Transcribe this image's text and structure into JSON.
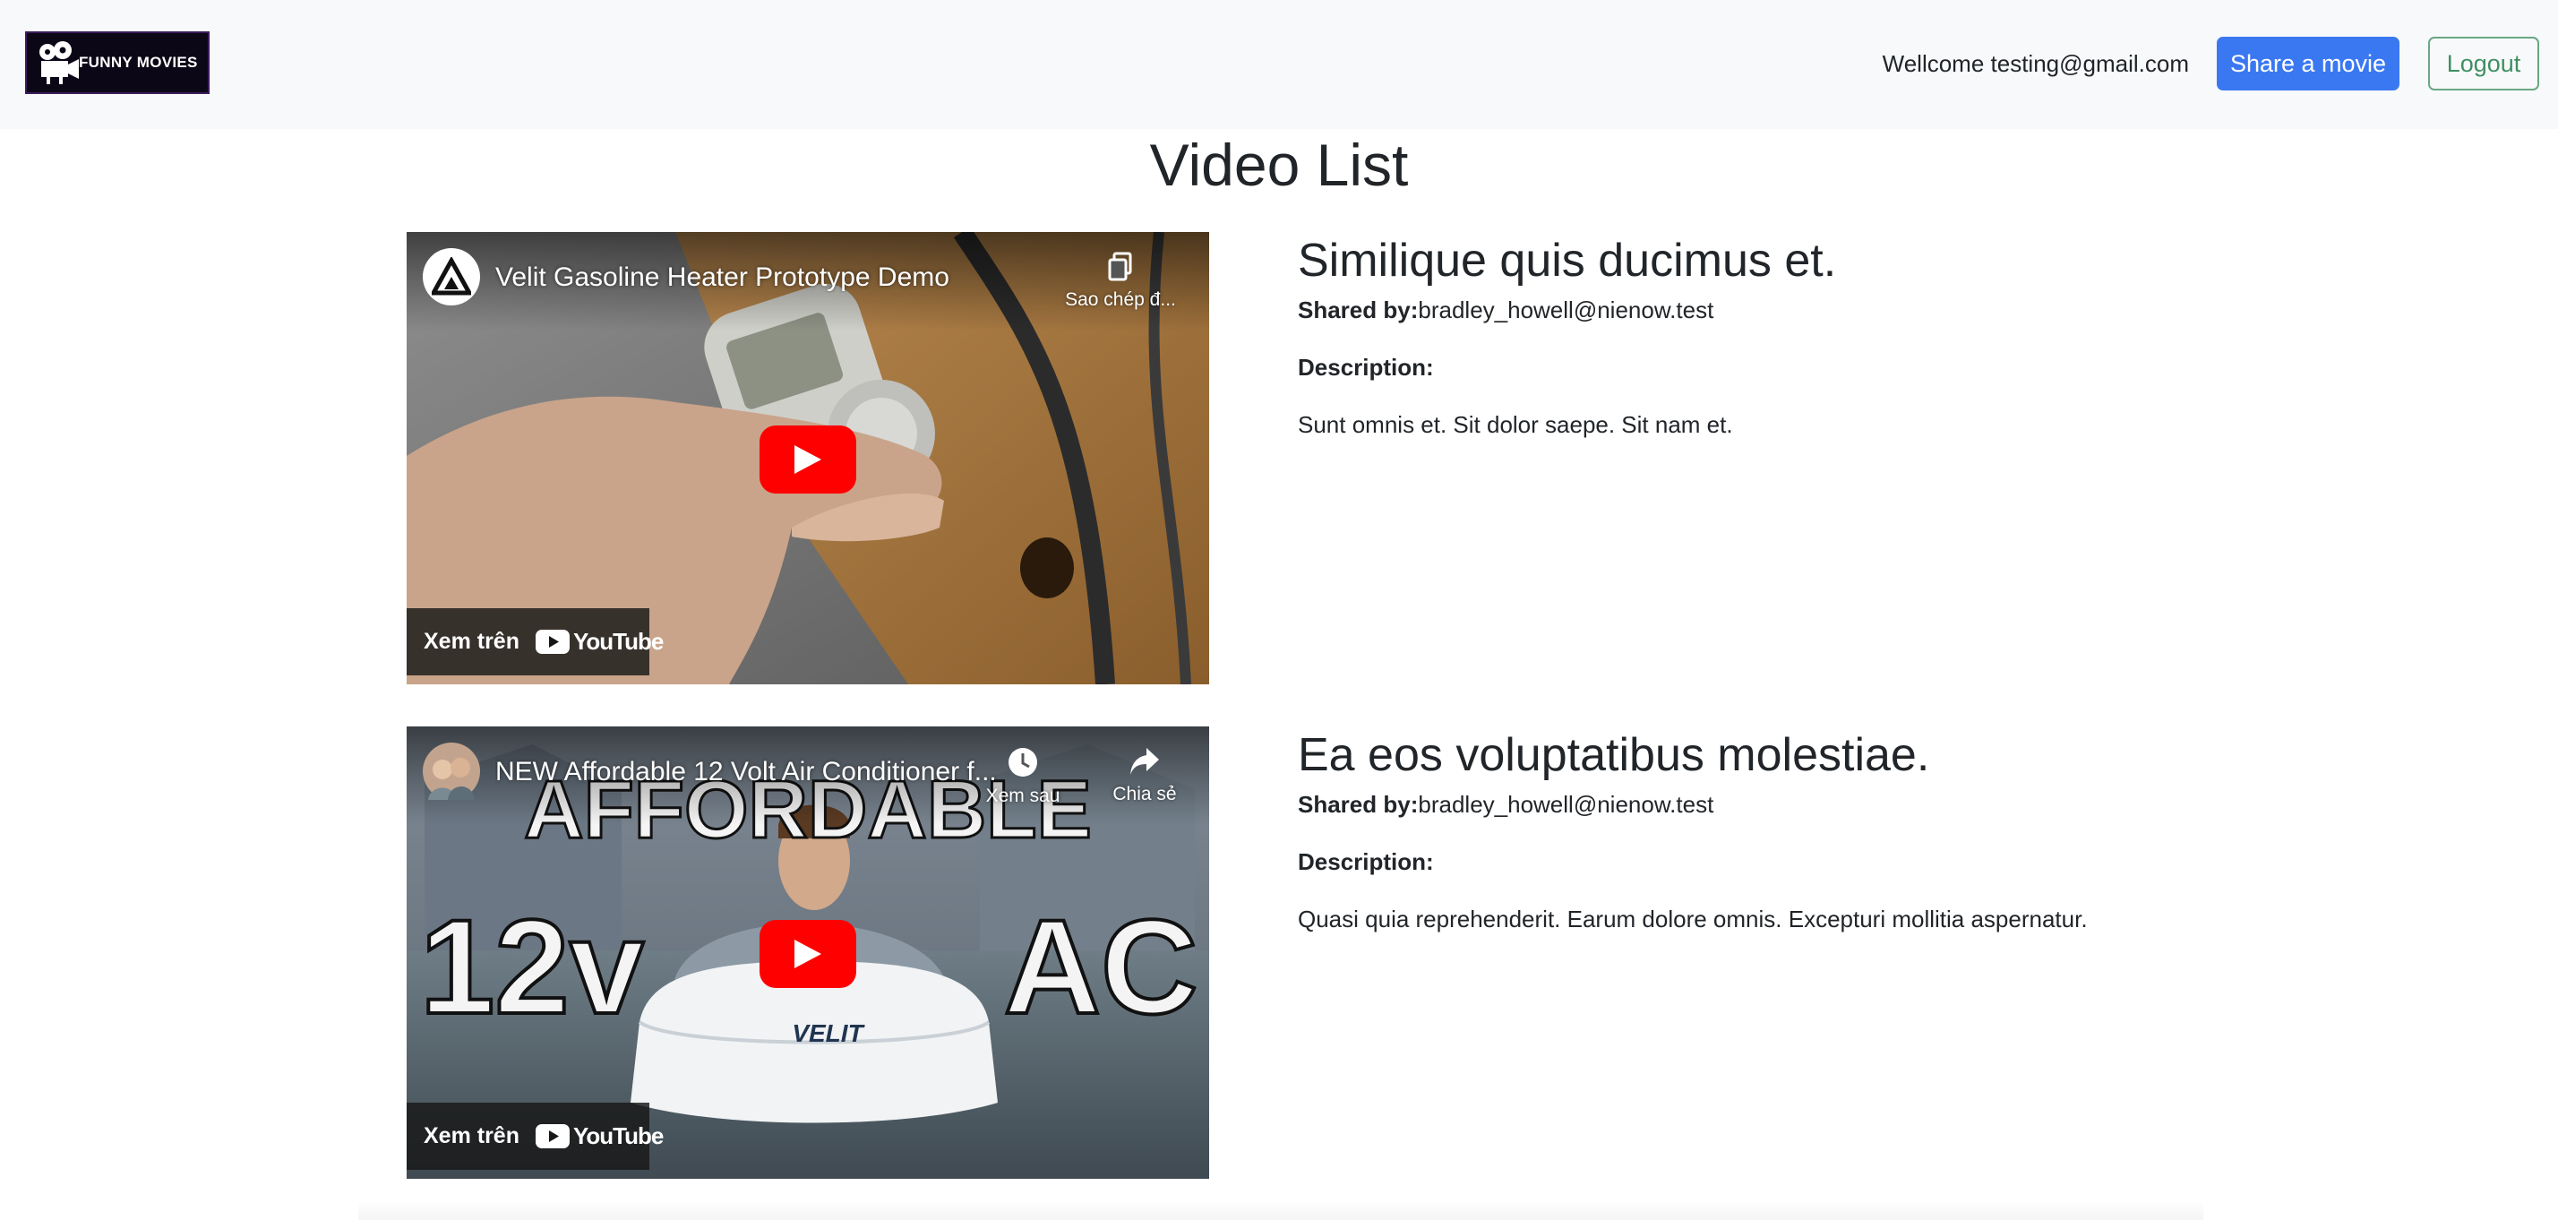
{
  "header": {
    "logo_text": "FUNNY MOVIES",
    "welcome_text": "Wellcome testing@gmail.com",
    "share_button": "Share a movie",
    "logout_button": "Logout"
  },
  "page_title": "Video List",
  "videos": [
    {
      "player": {
        "title": "Velit Gasoline Heater Prototype Demo",
        "copy_label": "Sao chép đ...",
        "watch_on": "Xem trên",
        "youtube": "YouTube"
      },
      "title": "Similique quis ducimus et.",
      "shared_by_label": "Shared by:",
      "shared_by": "bradley_howell@nienow.test",
      "description_label": "Description:",
      "description": "Sunt omnis et. Sit dolor saepe. Sit nam et."
    },
    {
      "player": {
        "title": "NEW Affordable 12 Volt Air Conditioner f...",
        "watch_later_label": "Xem sau",
        "share_label": "Chia sẻ",
        "thumb_text_top": "AFFORDABLE",
        "thumb_text_left": "12v",
        "thumb_text_right": "AC",
        "thumb_brand": "VELIT",
        "watch_on": "Xem trên",
        "youtube": "YouTube"
      },
      "title": "Ea eos voluptatibus molestiae.",
      "shared_by_label": "Shared by:",
      "shared_by": "bradley_howell@nienow.test",
      "description_label": "Description:",
      "description": "Quasi quia reprehenderit. Earum dolore omnis. Excepturi mollitia aspernatur."
    }
  ],
  "colors": {
    "navbar_bg": "#f8f9fa",
    "primary": "#3a78f2",
    "success_outline": "#3f8f63",
    "youtube_red": "#ff0000"
  }
}
